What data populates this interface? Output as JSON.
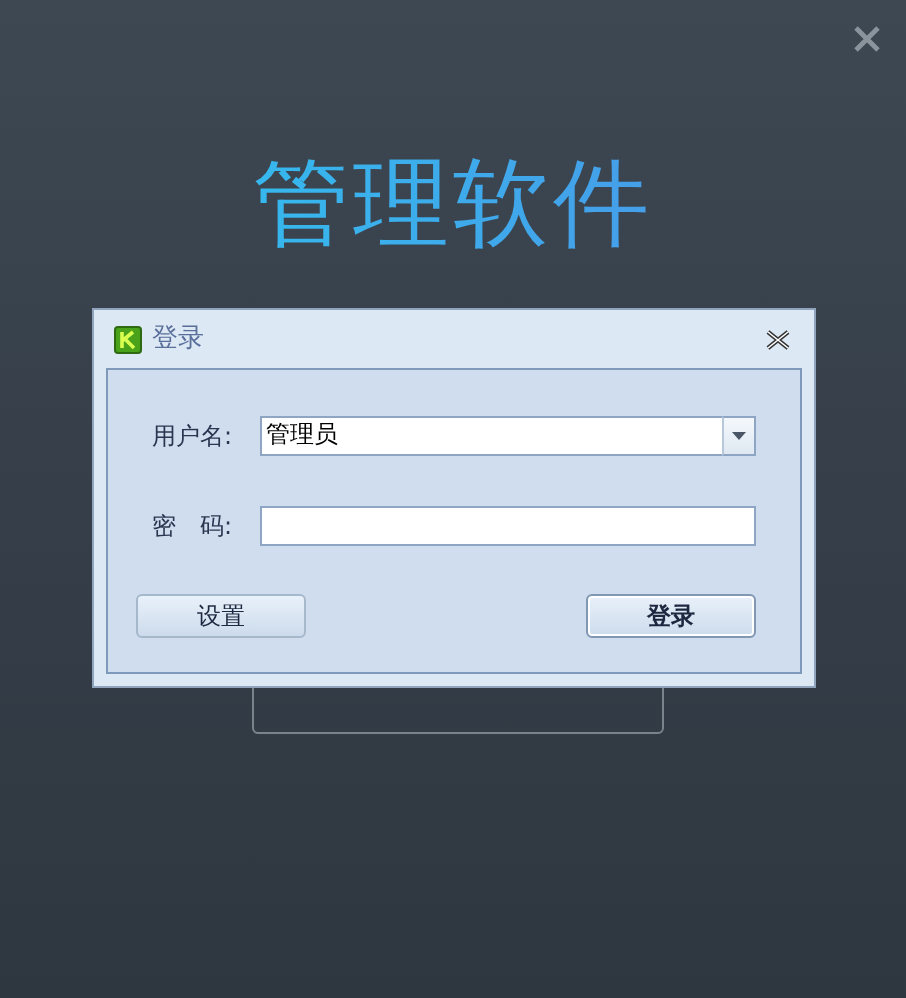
{
  "app_title": "管理软件",
  "dialog": {
    "title": "登录",
    "fields": [
      {
        "kind": "combo",
        "label": "用户名:",
        "value": "管理员"
      },
      {
        "kind": "password",
        "label": "密　码:"
      }
    ],
    "buttons": [
      {
        "label": "设置",
        "default": false
      },
      {
        "label": "登录",
        "default": true
      }
    ]
  }
}
